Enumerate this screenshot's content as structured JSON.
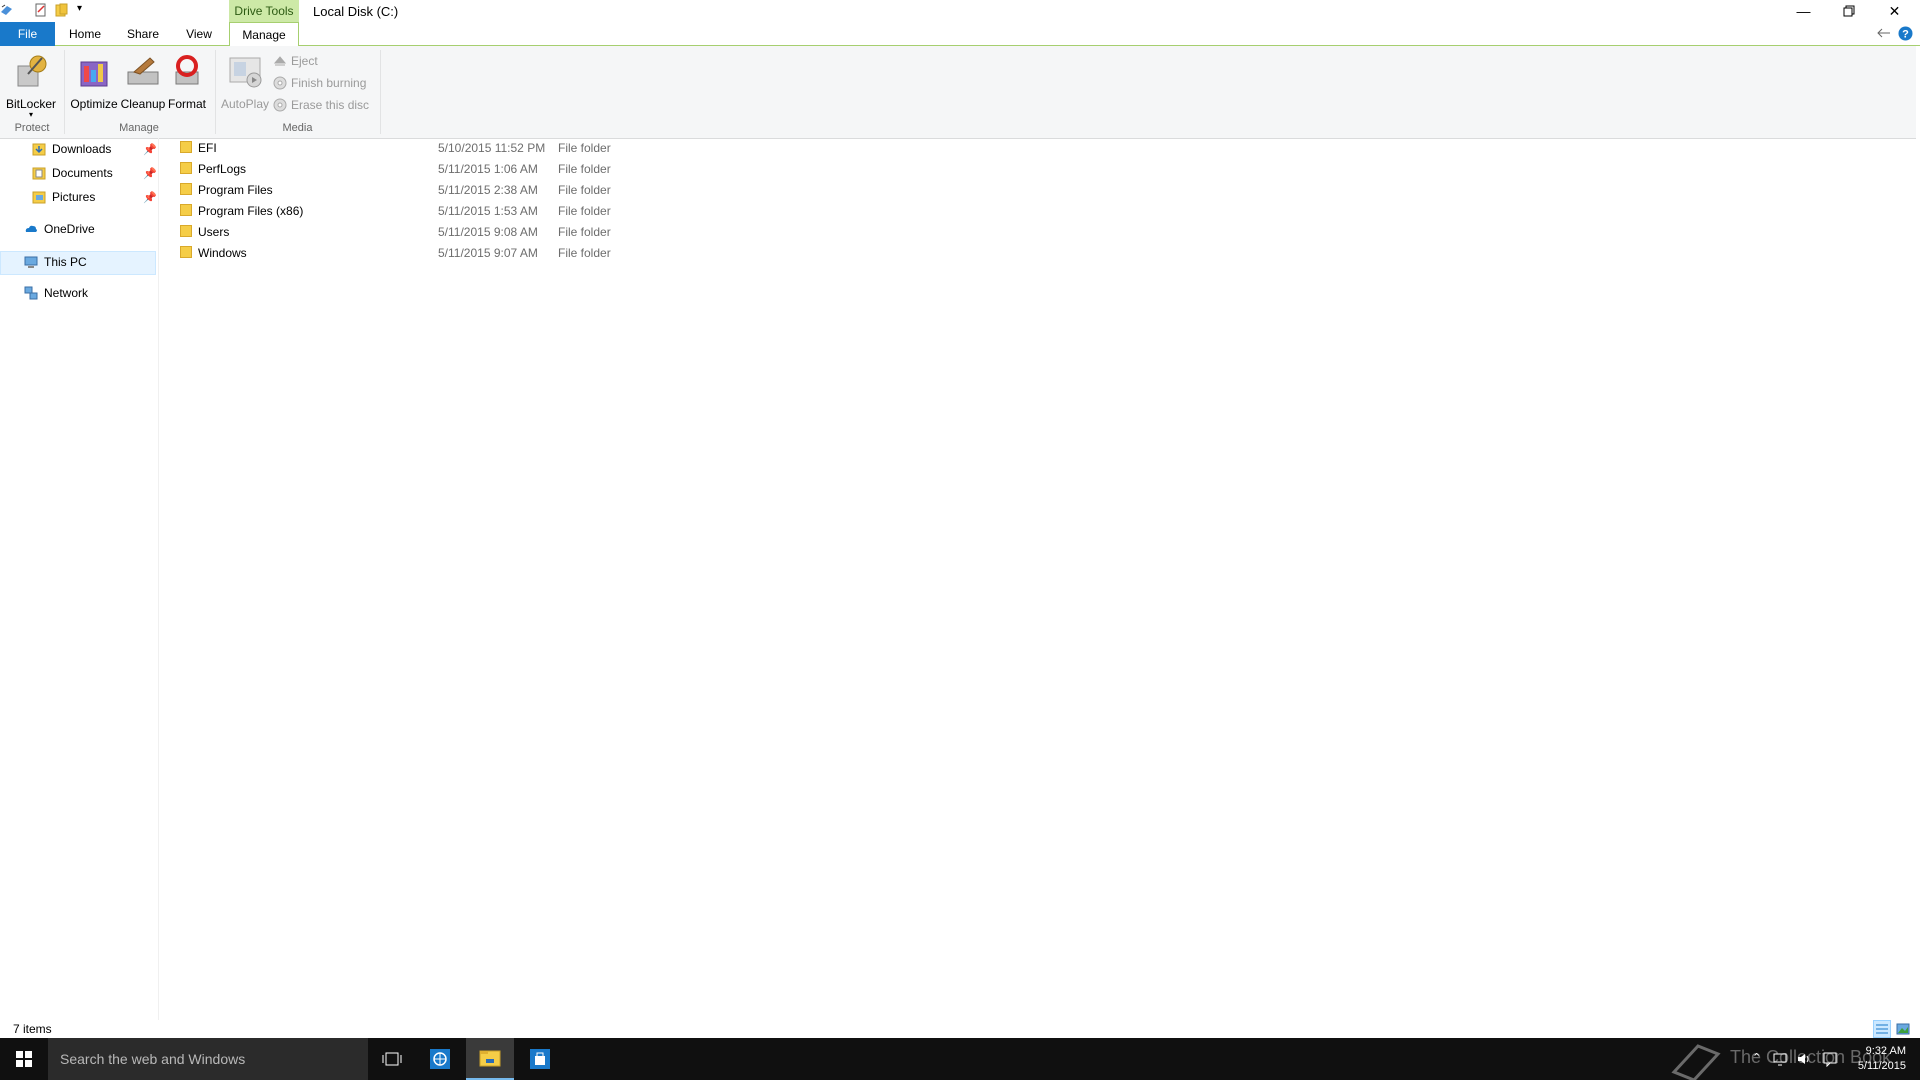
{
  "titlebar": {
    "context_tab": "Drive Tools",
    "title": "Local Disk (C:)"
  },
  "tabs": {
    "file": "File",
    "home": "Home",
    "share": "Share",
    "view": "View",
    "manage": "Manage"
  },
  "ribbon": {
    "bitlocker": "BitLocker",
    "optimize": "Optimize",
    "cleanup": "Cleanup",
    "format": "Format",
    "autoplay": "AutoPlay",
    "eject": "Eject",
    "finish_burning": "Finish burning",
    "erase_disc": "Erase this disc",
    "group_protect": "Protect",
    "group_manage": "Manage",
    "group_media": "Media"
  },
  "nav": {
    "downloads": "Downloads",
    "documents": "Documents",
    "pictures": "Pictures",
    "onedrive": "OneDrive",
    "this_pc": "This PC",
    "network": "Network"
  },
  "files": [
    {
      "name": "EFI",
      "date": "5/10/2015 11:52 PM",
      "type": "File folder"
    },
    {
      "name": "PerfLogs",
      "date": "5/11/2015 1:06 AM",
      "type": "File folder"
    },
    {
      "name": "Program Files",
      "date": "5/11/2015 2:38 AM",
      "type": "File folder"
    },
    {
      "name": "Program Files (x86)",
      "date": "5/11/2015 1:53 AM",
      "type": "File folder"
    },
    {
      "name": "Users",
      "date": "5/11/2015 9:08 AM",
      "type": "File folder"
    },
    {
      "name": "Windows",
      "date": "5/11/2015 9:07 AM",
      "type": "File folder"
    }
  ],
  "status": {
    "item_count": "7 items"
  },
  "taskbar": {
    "search_placeholder": "Search the web and Windows",
    "time": "9:32 AM",
    "date": "5/11/2015",
    "watermark": "The Collection Book"
  },
  "colors": {
    "accent": "#1979ca",
    "context_tab": "#cde9a7",
    "folder": "#f5cd47",
    "taskbar": "#101010"
  }
}
